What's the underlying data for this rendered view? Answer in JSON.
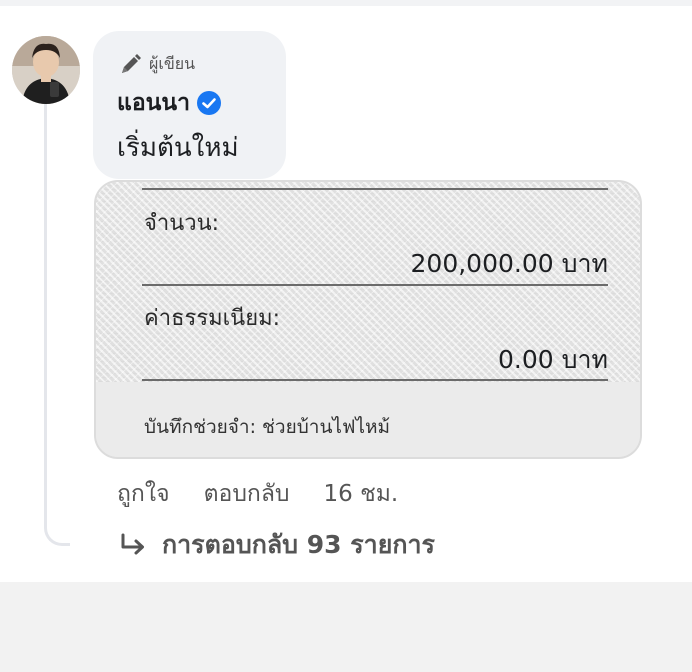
{
  "comment": {
    "author_badge": "ผู้เขียน",
    "author_name": "แอนนา",
    "text": "เริ่มต้นใหม่"
  },
  "transfer_card": {
    "amount_label": "จำนวน:",
    "amount_value": "200,000.00 บาท",
    "fee_label": "ค่าธรรมเนียม:",
    "fee_value": "0.00 บาท",
    "memo": "บันทึกช่วยจำ: ช่วยบ้านไฟไหม้"
  },
  "actions": {
    "like": "ถูกใจ",
    "reply": "ตอบกลับ",
    "time": "16 ชม."
  },
  "replies": {
    "label": "การตอบกลับ 93 รายการ"
  },
  "icons": {
    "author_badge": "pen-icon",
    "verified": "verified-check-icon",
    "reply_arrow": "reply-arrow-icon"
  },
  "colors": {
    "verified_blue": "#1877f2",
    "bubble_bg": "#f0f2f5",
    "secondary_text": "#555555"
  }
}
